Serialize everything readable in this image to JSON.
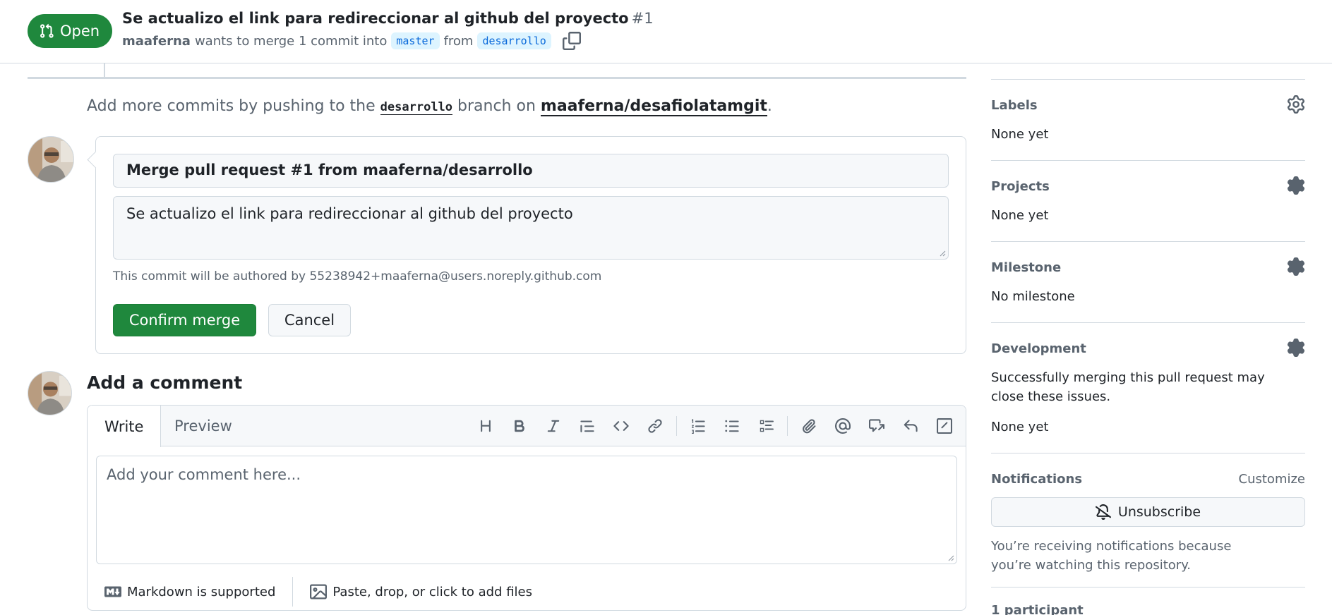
{
  "header": {
    "state_label": "Open",
    "title": "Se actualizo el link para redireccionar al github del proyecto",
    "number": "#1",
    "author": "maaferna",
    "merge_text": "wants to merge 1 commit into",
    "base_branch": "master",
    "from_text": "from",
    "head_branch": "desarrollo"
  },
  "push_hint": {
    "prefix": "Add more commits by pushing to the",
    "branch": "desarrollo",
    "middle": "branch on",
    "repo": "maaferna/desafiolatamgit",
    "suffix": "."
  },
  "merge_box": {
    "commit_title": "Merge pull request #1 from maaferna/desarrollo",
    "commit_body": "Se actualizo el link para redireccionar al github del proyecto",
    "author_note": "This commit will be authored by 55238942+maaferna@users.noreply.github.com",
    "confirm_label": "Confirm merge",
    "cancel_label": "Cancel"
  },
  "comment": {
    "heading": "Add a comment",
    "tab_write": "Write",
    "tab_preview": "Preview",
    "placeholder": "Add your comment here...",
    "markdown_note": "Markdown is supported",
    "attach_note": "Paste, drop, or click to add files",
    "toolbar_icons": [
      "heading-icon",
      "bold-icon",
      "italic-icon",
      "quote-icon",
      "code-icon",
      "link-icon",
      "ordered-list-icon",
      "unordered-list-icon",
      "task-list-icon",
      "attach-icon",
      "mention-icon",
      "reference-icon",
      "reply-icon",
      "slash-command-icon"
    ]
  },
  "sidebar": {
    "labels": {
      "title": "Labels",
      "value": "None yet"
    },
    "projects": {
      "title": "Projects",
      "value": "None yet"
    },
    "milestone": {
      "title": "Milestone",
      "value": "No milestone"
    },
    "development": {
      "title": "Development",
      "description": "Successfully merging this pull request may close these issues.",
      "value": "None yet"
    },
    "notifications": {
      "title": "Notifications",
      "customize": "Customize",
      "unsubscribe_label": "Unsubscribe",
      "note": "You’re receiving notifications because you’re watching this repository."
    },
    "participants": {
      "title": "1 participant"
    }
  },
  "colors": {
    "accent_green": "#1f883d",
    "branch_blue": "#0969da",
    "border": "#d1d9e0",
    "muted_text": "#59636e"
  }
}
